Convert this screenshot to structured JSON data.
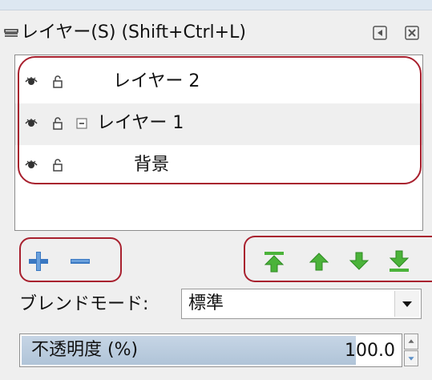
{
  "panel": {
    "title": "レイヤー(S) (Shift+Ctrl+L)",
    "buttons": [
      "restore-icon",
      "close-icon"
    ]
  },
  "layers": [
    {
      "name": "レイヤー 2",
      "selected": false,
      "expander": false,
      "icons": [
        "eye-icon",
        "lock-icon"
      ]
    },
    {
      "name": "レイヤー 1",
      "selected": true,
      "expander": true,
      "expander_icon": "collapse-box-icon",
      "icons": [
        "eye-icon",
        "lock-icon"
      ]
    },
    {
      "name": "背景",
      "selected": false,
      "expander": false,
      "icons": [
        "eye-icon",
        "lock-icon"
      ]
    }
  ],
  "toolbar": {
    "left": [
      "add-layer-icon",
      "remove-layer-icon"
    ],
    "right": [
      "move-to-top-icon",
      "move-up-icon",
      "move-down-icon",
      "move-to-bottom-icon"
    ]
  },
  "blend": {
    "label": "ブレンドモード:",
    "value": "標準"
  },
  "opacity": {
    "label": "不透明度 (%)",
    "value": "100.0",
    "fraction": 0.88
  },
  "colors": {
    "highlight": "#a8202e",
    "toolbar_icons": "#4bb33a",
    "add_remove_icons": "#3a78c2",
    "opacity_fill": "#b8cadd",
    "selected_row": "#efefef"
  }
}
